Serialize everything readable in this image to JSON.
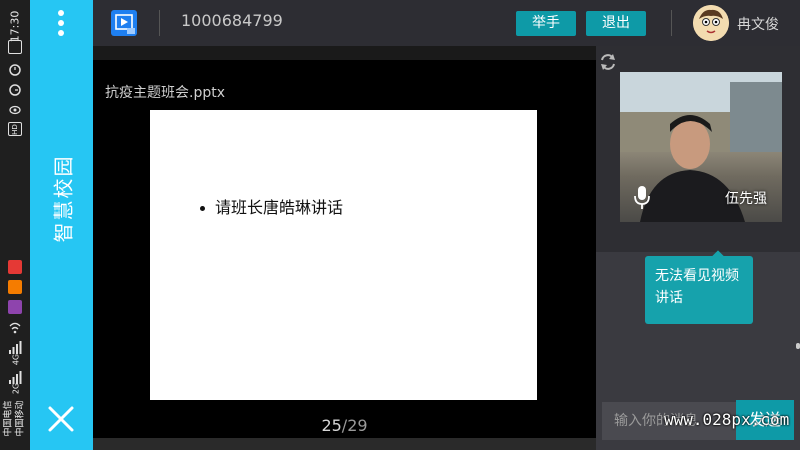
{
  "status_bar": {
    "time": "17:30",
    "carrier_1": "中国电信",
    "carrier_2": "中国移动",
    "network_1": "2G",
    "network_2": "4G",
    "hd_label": "HD"
  },
  "side_panel": {
    "title": "智慧校园"
  },
  "toolbar": {
    "meeting_id": "1000684799",
    "raise_hand_label": "举手",
    "exit_label": "退出",
    "user_name": "冉文俊"
  },
  "slide": {
    "file_name": "抗疫主题班会.pptx",
    "bullet": "请班长唐皓琳讲话",
    "current_page": "25",
    "separator": "/",
    "total_pages": "29"
  },
  "video": {
    "speaker_name": "伍先强"
  },
  "chat": {
    "message": "无法看见视频讲话",
    "input_placeholder": "输入你的消息",
    "send_label": "发送"
  },
  "watermark": "www.028px.com",
  "colors": {
    "side_panel": "#26c6f3",
    "accent_button": "#0e9aa7",
    "toolbar_bg": "#2d2d33",
    "chat_bubble": "#16a2ac"
  },
  "icons": {
    "menu": "more-vertical-icon",
    "close": "close-icon",
    "presentation": "play-presentation-icon",
    "refresh": "refresh-icon",
    "mic": "microphone-icon"
  }
}
